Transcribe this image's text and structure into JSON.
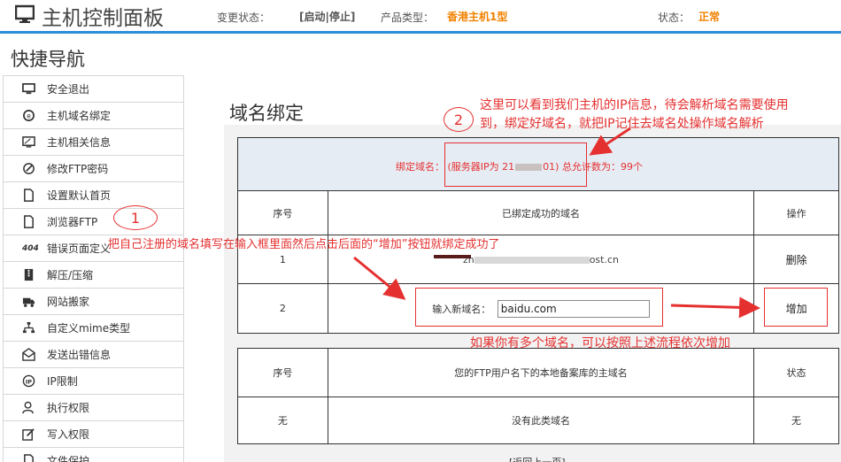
{
  "header": {
    "title": "主机控制面板",
    "change_status_label": "变更状态：",
    "change_status_actions": "[启动|停止]",
    "product_type_label": "产品类型：",
    "product_type_value": "香港主机1型",
    "status_label": "状态：",
    "status_value": "正常"
  },
  "sidebar": {
    "title": "快捷导航",
    "items": [
      {
        "label": "安全退出",
        "icon": "monitor-icon"
      },
      {
        "label": "主机域名绑定",
        "icon": "domain-icon"
      },
      {
        "label": "主机相关信息",
        "icon": "screen-icon"
      },
      {
        "label": "修改FTP密码",
        "icon": "pen-icon"
      },
      {
        "label": "设置默认首页",
        "icon": "document-icon"
      },
      {
        "label": "浏览器FTP",
        "icon": "document-icon"
      },
      {
        "label": "错误页面定义",
        "icon": "404-icon",
        "icon_text": "404"
      },
      {
        "label": "解压/压缩",
        "icon": "archive-icon"
      },
      {
        "label": "网站搬家",
        "icon": "truck-icon"
      },
      {
        "label": "自定义mime类型",
        "icon": "sitemap-icon"
      },
      {
        "label": "发送出错信息",
        "icon": "envelope-icon"
      },
      {
        "label": "IP限制",
        "icon": "ip-icon"
      },
      {
        "label": "执行权限",
        "icon": "user-icon"
      },
      {
        "label": "写入权限",
        "icon": "edit-icon"
      },
      {
        "label": "文件保护",
        "icon": "document-icon"
      }
    ]
  },
  "main": {
    "page_title": "域名绑定",
    "bind_label": "绑定域名：",
    "server_ip_prefix": "(服务器IP为 21",
    "server_ip_suffix": "01)",
    "allowed_count": "总允许数为：99个",
    "table1": {
      "headers": [
        "序号",
        "已绑定成功的域名",
        "操作"
      ],
      "row1": {
        "index": "1",
        "domain_start": "zh",
        "domain_end": "ost.cn",
        "action": "删除"
      },
      "row2": {
        "index": "2",
        "input_label": "输入新域名：",
        "input_value": "baidu.com",
        "action": "增加"
      }
    },
    "table2": {
      "headers": [
        "序号",
        "您的FTP用户名下的本地备案库的主域名",
        "状态"
      ],
      "row1": {
        "index": "无",
        "domain": "没有此类域名",
        "status": "无"
      }
    },
    "pager": "[返回上一页]"
  },
  "annotations": {
    "circle_1": "1",
    "circle_2": "2",
    "note_ip_line1": "这里可以看到我们主机的IP信息，待会解析域名需要使用",
    "note_ip_line2": "到，绑定好域名，就把IP记住去域名处操作域名解析",
    "note_input": "把自己注册的域名填写在输入框里面然后点击后面的“增加”按钮就绑定成功了",
    "note_more": "如果你有多个域名，可以按照上述流程依次增加"
  },
  "colors": {
    "accent": "#2a8fd8",
    "orange": "#f08200",
    "annotation": "#e53030"
  }
}
